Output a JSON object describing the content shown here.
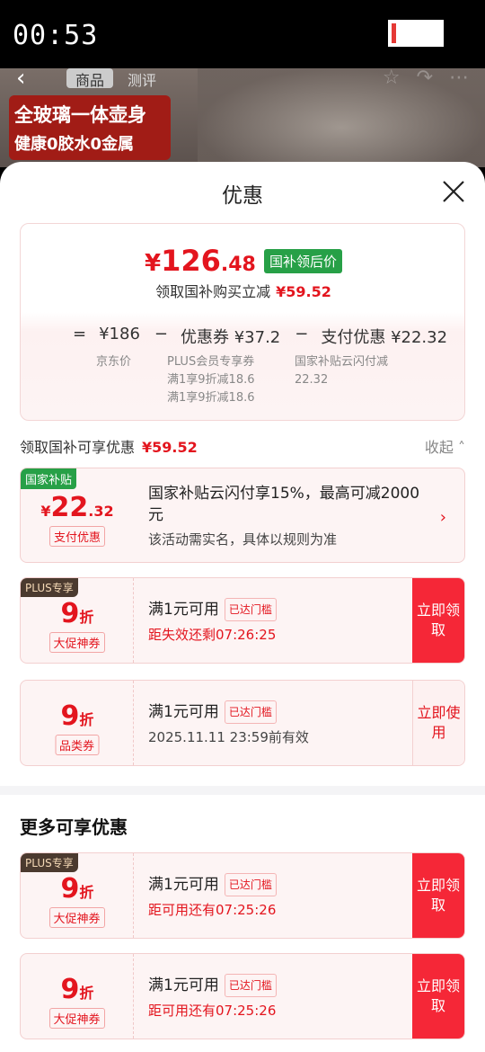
{
  "status_bar": {
    "time": "00:53"
  },
  "backdrop": {
    "tabs": [
      "商品",
      "测评"
    ],
    "banner_line1": "全玻璃一体壶身",
    "banner_line2": "健康0胶水0金属"
  },
  "sheet": {
    "title": "优惠"
  },
  "summary": {
    "currency": "¥",
    "price_int": "126",
    "price_dec": ".48",
    "price_badge": "国补领后价",
    "sub_text": "领取国补购买立减",
    "sub_amount": "¥59.52",
    "formula": {
      "eq": "=",
      "base": "¥186",
      "minus1": "−",
      "coupon": "优惠券 ¥37.2",
      "minus2": "−",
      "pay": "支付优惠 ¥22.32",
      "base_label": "京东价",
      "coupon_lines": [
        "PLUS会员专享券",
        "满1享9折减18.6",
        "满1享9折减18.6"
      ],
      "pay_lines": [
        "国家补贴云闪付减",
        "22.32"
      ]
    }
  },
  "gov_section": {
    "label": "领取国补可享优惠",
    "amount": "¥59.52",
    "collapse": "收起 ˄"
  },
  "coupons": [
    {
      "tag": "国家补贴",
      "amount_prefix": "¥",
      "amount": "22",
      "amount_suffix": ".32",
      "kind": "支付优惠",
      "title": "国家补贴云闪付享15%，最高可减2000元",
      "desc": "该活动需实名，具体以规则为准"
    },
    {
      "tag": "PLUS专享",
      "amount": "9",
      "amount_suffix": "折",
      "kind": "大促神券",
      "title": "满1元可用",
      "met": "已达门槛",
      "desc": "距失效还剩07:26:25",
      "action": "立即领取"
    },
    {
      "amount": "9",
      "amount_suffix": "折",
      "kind": "品类券",
      "title": "满1元可用",
      "met": "已达门槛",
      "desc": "2025.11.11 23:59前有效",
      "action": "立即使用"
    }
  ],
  "more_section": {
    "title": "更多可享优惠"
  },
  "more_coupons": [
    {
      "tag": "PLUS专享",
      "amount": "9",
      "amount_suffix": "折",
      "kind": "大促神券",
      "title": "满1元可用",
      "met": "已达门槛",
      "desc": "距可用还有07:25:26",
      "action": "立即领取"
    },
    {
      "amount": "9",
      "amount_suffix": "折",
      "kind": "大促神券",
      "title": "满1元可用",
      "met": "已达门槛",
      "desc": "距可用还有07:25:26",
      "action": "立即领取"
    }
  ]
}
